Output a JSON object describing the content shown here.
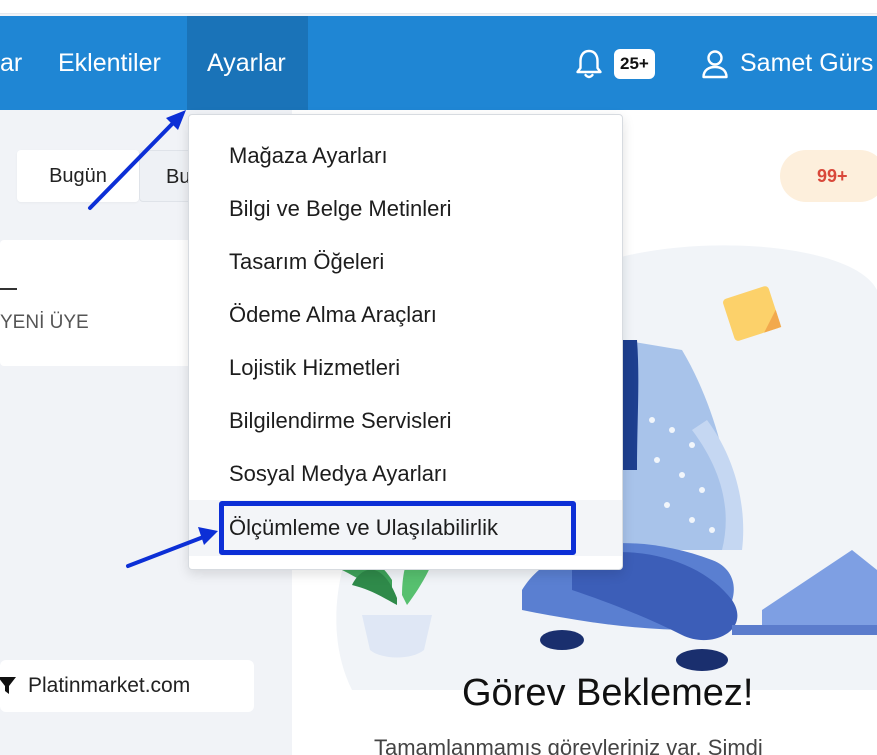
{
  "navbar": {
    "items": [
      {
        "label": "ar"
      },
      {
        "label": "Eklentiler"
      },
      {
        "label": "Ayarlar"
      }
    ],
    "notification_count": "25+",
    "user_name": "Samet Gürs",
    "color": "#1f86d4",
    "active_color": "#1a73b8"
  },
  "dashboard": {
    "date_buttons": [
      "Bugün",
      "Bu"
    ],
    "card_label": "YENİ ÜYE",
    "store_name": "Platinmarket.com",
    "badge": "99+"
  },
  "dropdown": {
    "items": [
      {
        "label": "Mağaza Ayarları"
      },
      {
        "label": "Bilgi ve Belge Metinleri"
      },
      {
        "label": "Tasarım Öğeleri"
      },
      {
        "label": "Ödeme Alma Araçları"
      },
      {
        "label": "Lojistik Hizmetleri"
      },
      {
        "label": "Bilgilendirme Servisleri"
      },
      {
        "label": "Sosyal Medya Ayarları"
      },
      {
        "label": "Ölçümleme ve Ulaşılabilirlik"
      }
    ],
    "highlighted_item": "Ölçümleme ve Ulaşılabilirlik"
  },
  "empty_state": {
    "title": "Görev Beklemez!",
    "subtitle": "Tamamlanmamış görevleriniz var. Şimdi"
  },
  "annotation": {
    "color": "#0c2fd6"
  }
}
